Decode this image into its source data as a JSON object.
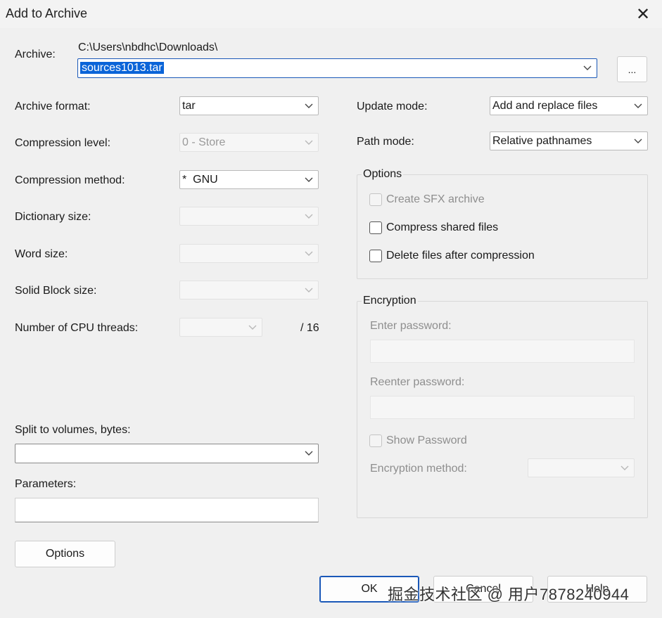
{
  "window": {
    "title": "Add to Archive",
    "close_glyph": "✕"
  },
  "archive": {
    "label": "Archive:",
    "path": "C:\\Users\\nbdhc\\Downloads\\",
    "filename": "sources1013.tar",
    "browse_label": "..."
  },
  "left": {
    "archive_format": {
      "label": "Archive format:",
      "value": "tar"
    },
    "compression_level": {
      "label": "Compression level:",
      "value": "0 - Store"
    },
    "compression_method": {
      "label": "Compression method:",
      "value": "*  GNU"
    },
    "dictionary_size": {
      "label": "Dictionary size:",
      "value": ""
    },
    "word_size": {
      "label": "Word size:",
      "value": ""
    },
    "solid_block_size": {
      "label": "Solid Block size:",
      "value": ""
    },
    "cpu_threads": {
      "label": "Number of CPU threads:",
      "value": "",
      "total": "/ 16"
    },
    "split_volumes": {
      "label": "Split to volumes, bytes:",
      "value": ""
    },
    "parameters": {
      "label": "Parameters:",
      "value": ""
    },
    "options_button": "Options"
  },
  "right": {
    "update_mode": {
      "label": "Update mode:",
      "value": "Add and replace files"
    },
    "path_mode": {
      "label": "Path mode:",
      "value": "Relative pathnames"
    },
    "options_group": {
      "title": "Options",
      "create_sfx": "Create SFX archive",
      "compress_shared": "Compress shared files",
      "delete_after": "Delete files after compression"
    },
    "encryption_group": {
      "title": "Encryption",
      "enter_password": "Enter password:",
      "reenter_password": "Reenter password:",
      "show_password": "Show Password",
      "method_label": "Encryption method:",
      "method_value": ""
    }
  },
  "footer": {
    "ok": "OK",
    "cancel": "Cancel",
    "help": "Help",
    "watermark": "掘金技术社区 @ 用户7878240944"
  }
}
